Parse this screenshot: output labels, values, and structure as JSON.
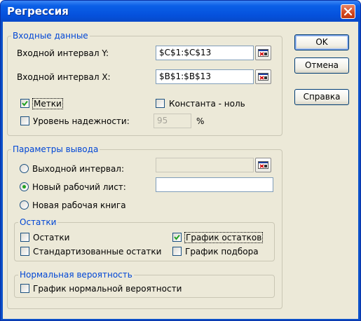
{
  "window": {
    "title": "Регрессия"
  },
  "input_group": {
    "legend": "Входные данные",
    "y_label": "Входной интервал Y:",
    "y_value": "$C$1:$C$13",
    "x_label": "Входной интервал X:",
    "x_value": "$B$1:$B$13",
    "labels_check": {
      "label": "Метки",
      "checked": true
    },
    "const_zero_check": {
      "label": "Константа - ноль",
      "checked": false
    },
    "confidence_check": {
      "label": "Уровень надежности:",
      "checked": false
    },
    "confidence_value": "95",
    "confidence_unit": "%"
  },
  "output_group": {
    "legend": "Параметры вывода",
    "output_range_radio": {
      "label": "Выходной интервал:",
      "checked": false
    },
    "output_range_value": "",
    "new_sheet_radio": {
      "label": "Новый рабочий лист:",
      "checked": true
    },
    "new_sheet_value": "",
    "new_book_radio": {
      "label": "Новая рабочая книга",
      "checked": false
    }
  },
  "residuals_group": {
    "legend": "Остатки",
    "residuals": {
      "label": "Остатки",
      "checked": false
    },
    "std_residuals": {
      "label": "Стандартизованные остатки",
      "checked": false
    },
    "residual_plot": {
      "label": "График остатков",
      "checked": true
    },
    "fit_plot": {
      "label": "График подбора",
      "checked": false
    }
  },
  "normal_group": {
    "legend": "Нормальная вероятность",
    "normal_plot": {
      "label": "График нормальной вероятности",
      "checked": false
    }
  },
  "buttons": {
    "ok": "OK",
    "cancel": "Отмена",
    "help": "Справка"
  },
  "colors": {
    "titlebar": "#0551dc",
    "group_legend": "#0046d5",
    "client": "#ece9d8",
    "check_mark": "#21a121"
  },
  "icons": {
    "close": "close-icon",
    "range_ref": "collapse-dialog-icon",
    "check": "check-icon"
  }
}
